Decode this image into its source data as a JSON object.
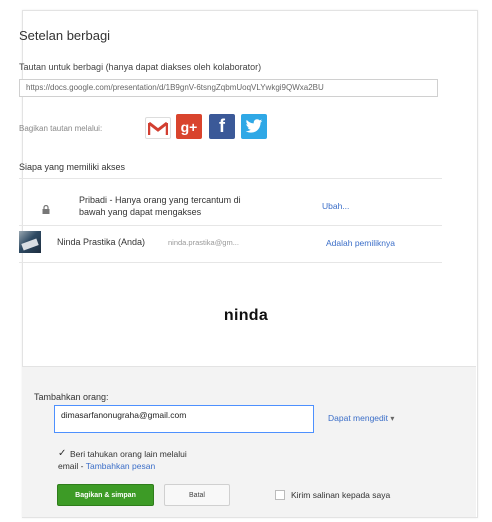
{
  "dialog": {
    "title": "Setelan berbagi",
    "share_link_label": "Tautan untuk berbagi (hanya dapat diakses oleh kolaborator)",
    "share_url": "https://docs.google.com/presentation/d/1B9gnV-6tsngZqbmUoqVLYwkgi9QWxa2BU",
    "share_via_label": "Bagikan tautan melalui:",
    "social": {
      "gmail": "M",
      "gplus": "g+",
      "facebook": "f",
      "twitter": ""
    }
  },
  "access": {
    "label": "Siapa yang memiliki akses",
    "private_line1": "Pribadi - Hanya orang yang tercantum di",
    "private_line2": "bawah yang dapat mengakses",
    "change_link": "Ubah...",
    "owner_name": "Ninda Prastika (Anda)",
    "owner_email": "ninda.prastika@gm...",
    "owner_role": "Adalah pemiliknya"
  },
  "overlay_text": "ninda",
  "add_people": {
    "label": "Tambahkan orang:",
    "input_value": "dimasarfanonugraha@gmail.com",
    "permission": "Dapat mengedit",
    "permission_caret": "▾",
    "notify_check": "✓",
    "notify_line1": "Beri tahukan orang lain melalui",
    "notify_line2_prefix": "email - ",
    "notify_add_message": "Tambahkan pesan",
    "share_button": "Bagikan & simpan",
    "cancel_button": "Batal",
    "send_copy_label": "Kirim salinan kepada saya"
  },
  "colors": {
    "share_button": "#3d9b26",
    "link": "#3b6ec8",
    "panel_bg": "#f3f3f3"
  }
}
